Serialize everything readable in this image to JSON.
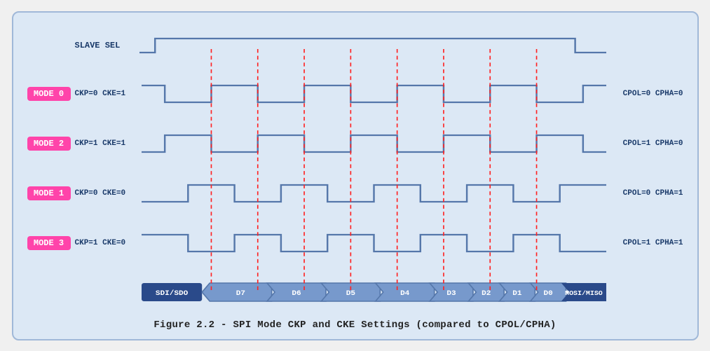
{
  "caption": "Figure 2.2 - SPI Mode CKP and CKE Settings (compared to CPOL/CPHA)",
  "slave_label": "SLAVE SEL",
  "modes": [
    {
      "badge": "MODE 0",
      "left": "CKP=0  CKE=1",
      "right": "CPOL=0  CPHA=0",
      "wave_type": "high_start"
    },
    {
      "badge": "MODE 2",
      "left": "CKP=1  CKE=1",
      "right": "CPOL=1  CPHA=0",
      "wave_type": "low_start"
    },
    {
      "badge": "MODE 1",
      "left": "CKP=0  CKE=0",
      "right": "CPOL=0  CPHA=1",
      "wave_type": "high_start_shifted"
    },
    {
      "badge": "MODE 3",
      "left": "CKP=1  CKE=0",
      "right": "CPOL=1  CPHA=1",
      "wave_type": "low_start_shifted"
    }
  ],
  "data_bits": [
    "SDI/SDO",
    "D7",
    "D6",
    "D5",
    "D4",
    "D3",
    "D2",
    "D1",
    "D0",
    "MOSI/MISO"
  ],
  "colors": {
    "wave_stroke": "#5577aa",
    "wave_fill": "none",
    "dashed_line": "#ff2222",
    "badge_bg": "#ff44aa",
    "bus_fill": "#2a4a8a",
    "bus_text": "#ffffff",
    "bus_cell_fill": "#7799cc"
  }
}
